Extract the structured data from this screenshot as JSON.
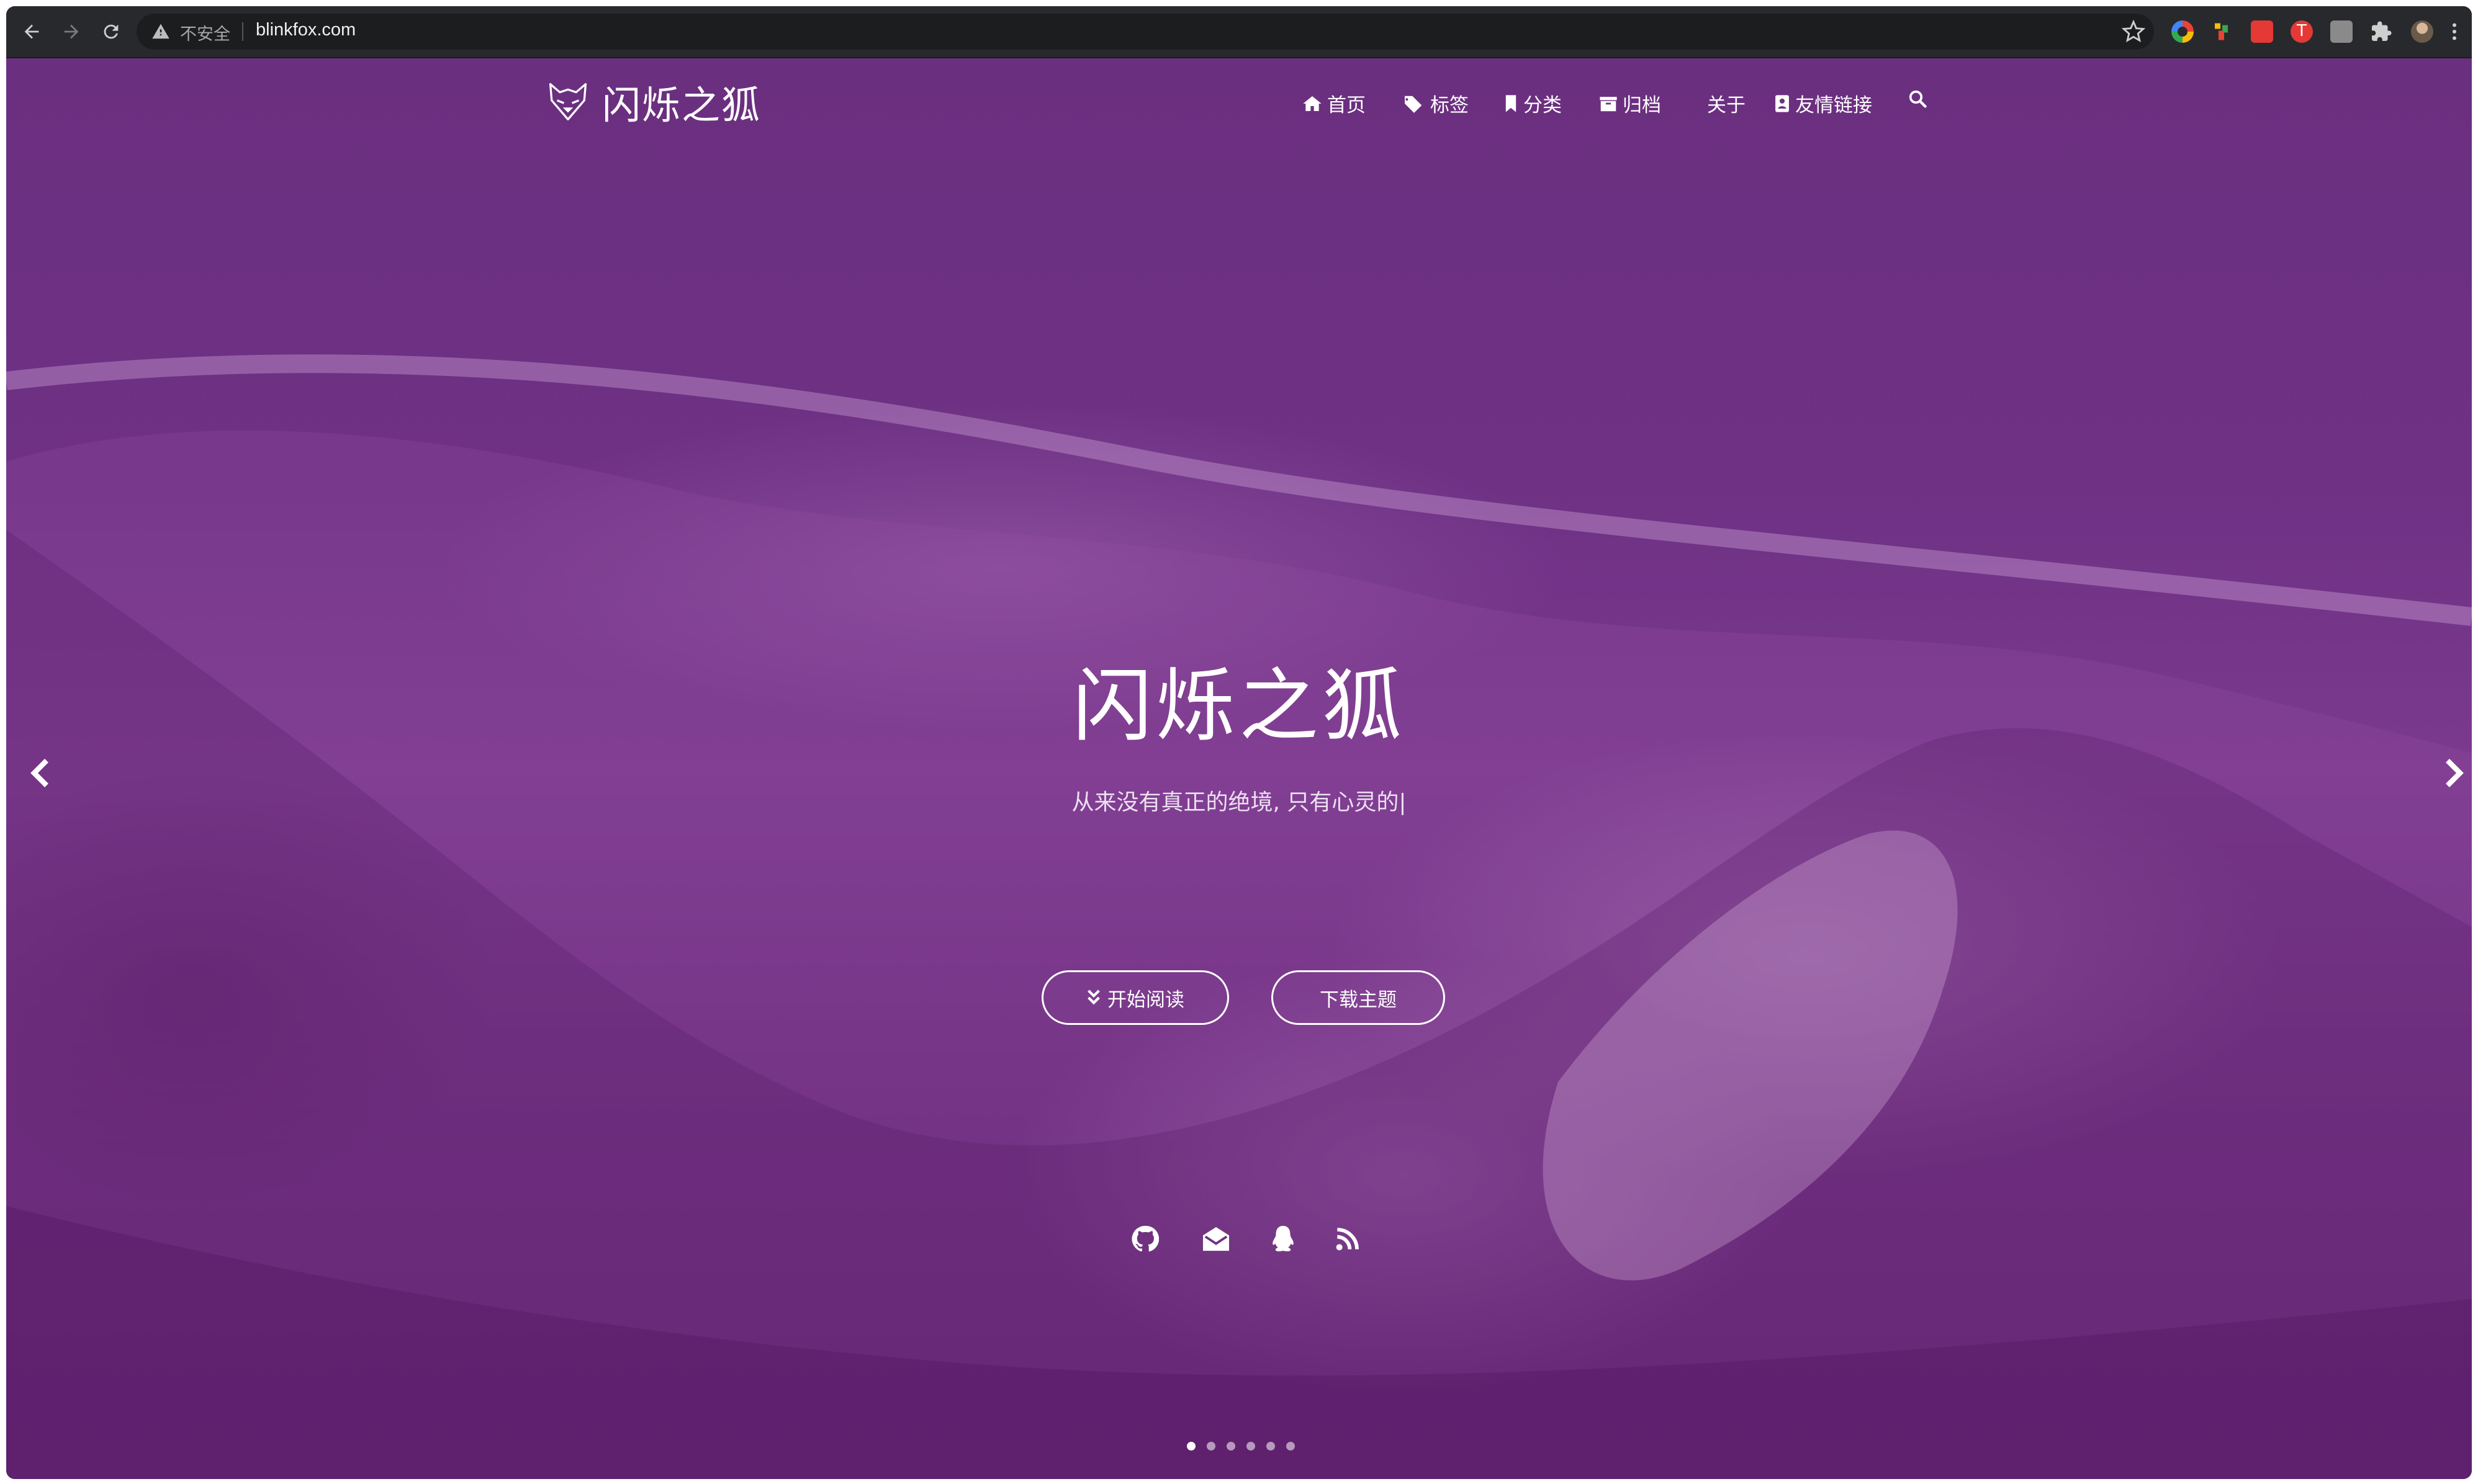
{
  "browser": {
    "insecure_label": "不安全",
    "url": "blinkfox.com"
  },
  "site": {
    "logo_text": "闪烁之狐",
    "nav": [
      {
        "label": "首页",
        "icon": "home-icon"
      },
      {
        "label": "标签",
        "icon": "tags-icon"
      },
      {
        "label": "分类",
        "icon": "bookmark-icon"
      },
      {
        "label": "归档",
        "icon": "archive-icon"
      },
      {
        "label": "关于",
        "icon": "user-icon"
      },
      {
        "label": "友情链接",
        "icon": "address-card-icon"
      }
    ]
  },
  "hero": {
    "title": "闪烁之狐",
    "subtitle": "从来没有真正的绝境, 只有心灵的|",
    "start_button": "开始阅读",
    "download_button": "下载主题"
  },
  "social_icons": [
    "github-icon",
    "email-icon",
    "qq-icon",
    "rss-icon"
  ],
  "carousel": {
    "slides": 6,
    "active_index": 0
  },
  "colors": {
    "overlay": "#6e3184",
    "text": "#ffffff"
  }
}
